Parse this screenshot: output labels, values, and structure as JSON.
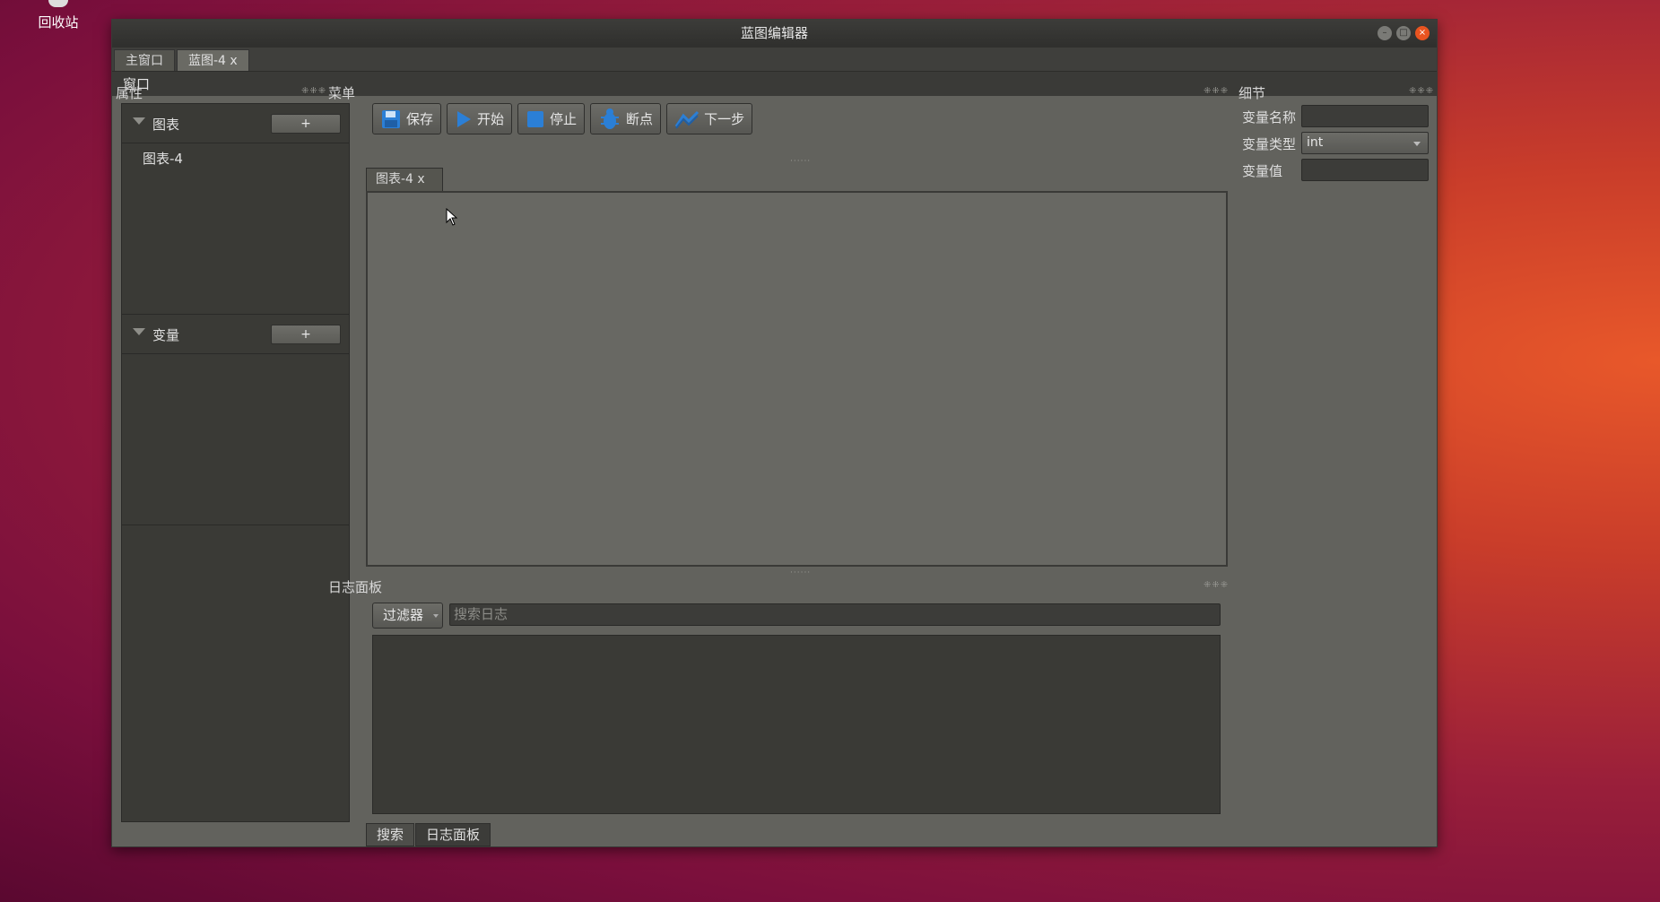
{
  "desktop": {
    "trash_label": "回收站"
  },
  "window": {
    "title": "蓝图编辑器",
    "tabs": [
      {
        "label": "主窗口"
      },
      {
        "label": "蓝图-4  x"
      }
    ],
    "menubar": {
      "window_menu": "窗口"
    }
  },
  "properties_panel": {
    "title": "属性",
    "sections": [
      {
        "label": "图表",
        "add_label": "+",
        "items": [
          "图表-4"
        ]
      },
      {
        "label": "变量",
        "add_label": "+",
        "items": []
      }
    ]
  },
  "menu_panel": {
    "title": "菜单",
    "toolbar": [
      {
        "label": "保存",
        "icon": "save-icon"
      },
      {
        "label": "开始",
        "icon": "play-icon"
      },
      {
        "label": "停止",
        "icon": "stop-icon"
      },
      {
        "label": "断点",
        "icon": "bug-icon"
      },
      {
        "label": "下一步",
        "icon": "step-icon"
      }
    ],
    "doc_tab": "图表-4  x"
  },
  "log_panel": {
    "title": "日志面板",
    "filter_label": "过滤器",
    "search_placeholder": "搜索日志"
  },
  "bottom_tabs": [
    {
      "label": "搜索"
    },
    {
      "label": "日志面板"
    }
  ],
  "details_panel": {
    "title": "细节",
    "var_name_label": "变量名称",
    "var_type_label": "变量类型",
    "var_type_value": "int",
    "var_value_label": "变量值"
  },
  "colors": {
    "accent": "#e95420",
    "icon_blue": "#2b7fd6"
  }
}
